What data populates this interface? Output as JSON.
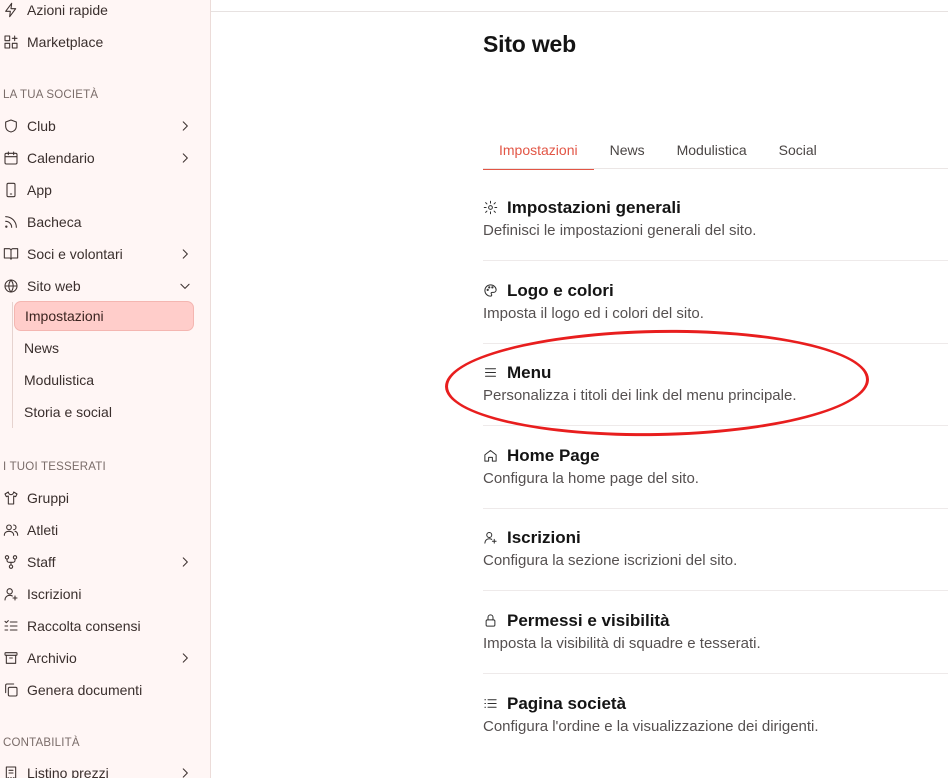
{
  "sidebar": {
    "top_items": [
      {
        "label": "Azioni rapide",
        "icon": "lightning-icon"
      },
      {
        "label": "Marketplace",
        "icon": "grid-plus-icon"
      }
    ],
    "section_company": "LA TUA SOCIETÀ",
    "company_items": [
      {
        "label": "Club",
        "icon": "shield-icon",
        "chevron": "right"
      },
      {
        "label": "Calendario",
        "icon": "calendar-icon",
        "chevron": "right"
      },
      {
        "label": "App",
        "icon": "smartphone-icon"
      },
      {
        "label": "Bacheca",
        "icon": "rss-icon"
      },
      {
        "label": "Soci e volontari",
        "icon": "book-open-icon",
        "chevron": "right"
      },
      {
        "label": "Sito web",
        "icon": "globe-icon",
        "chevron": "down"
      }
    ],
    "website_subitems": [
      "Impostazioni",
      "News",
      "Modulistica",
      "Storia e social"
    ],
    "active_subitem": "Impostazioni",
    "section_members": "I TUOI TESSERATI",
    "members_items": [
      {
        "label": "Gruppi",
        "icon": "shirt-icon"
      },
      {
        "label": "Atleti",
        "icon": "users-icon"
      },
      {
        "label": "Staff",
        "icon": "network-icon",
        "chevron": "right"
      },
      {
        "label": "Iscrizioni",
        "icon": "user-plus-icon"
      },
      {
        "label": "Raccolta consensi",
        "icon": "list-check-icon"
      },
      {
        "label": "Archivio",
        "icon": "archive-icon",
        "chevron": "right"
      },
      {
        "label": "Genera documenti",
        "icon": "copy-icon"
      }
    ],
    "section_accounting": "CONTABILITÀ",
    "accounting_items": [
      {
        "label": "Listino prezzi",
        "icon": "receipt-icon",
        "chevron": "right"
      }
    ]
  },
  "main": {
    "title": "Sito web",
    "tabs": [
      "Impostazioni",
      "News",
      "Modulistica",
      "Social"
    ],
    "active_tab": "Impostazioni",
    "settings": [
      {
        "title": "Impostazioni generali",
        "description": "Definisci le impostazioni generali del sito.",
        "icon": "gear-icon"
      },
      {
        "title": "Logo e colori",
        "description": "Imposta il logo ed i colori del sito.",
        "icon": "palette-icon"
      },
      {
        "title": "Menu",
        "description": "Personalizza i titoli dei link del menu principale.",
        "icon": "menu-lines-icon"
      },
      {
        "title": "Home Page",
        "description": "Configura la home page del sito.",
        "icon": "home-icon"
      },
      {
        "title": "Iscrizioni",
        "description": "Configura la sezione iscrizioni del sito.",
        "icon": "user-plus-icon"
      },
      {
        "title": "Permessi e visibilità",
        "description": "Imposta la visibilità di squadre e tesserati.",
        "icon": "lock-icon"
      },
      {
        "title": "Pagina società",
        "description": "Configura l'ordine e la visualizzazione dei dirigenti.",
        "icon": "list-icon"
      }
    ]
  },
  "colors": {
    "accent": "#e25545",
    "sidebar_bg": "#fff6f5",
    "active_item_bg": "#ffcdca",
    "annotation_ring": "#e81e1e"
  }
}
